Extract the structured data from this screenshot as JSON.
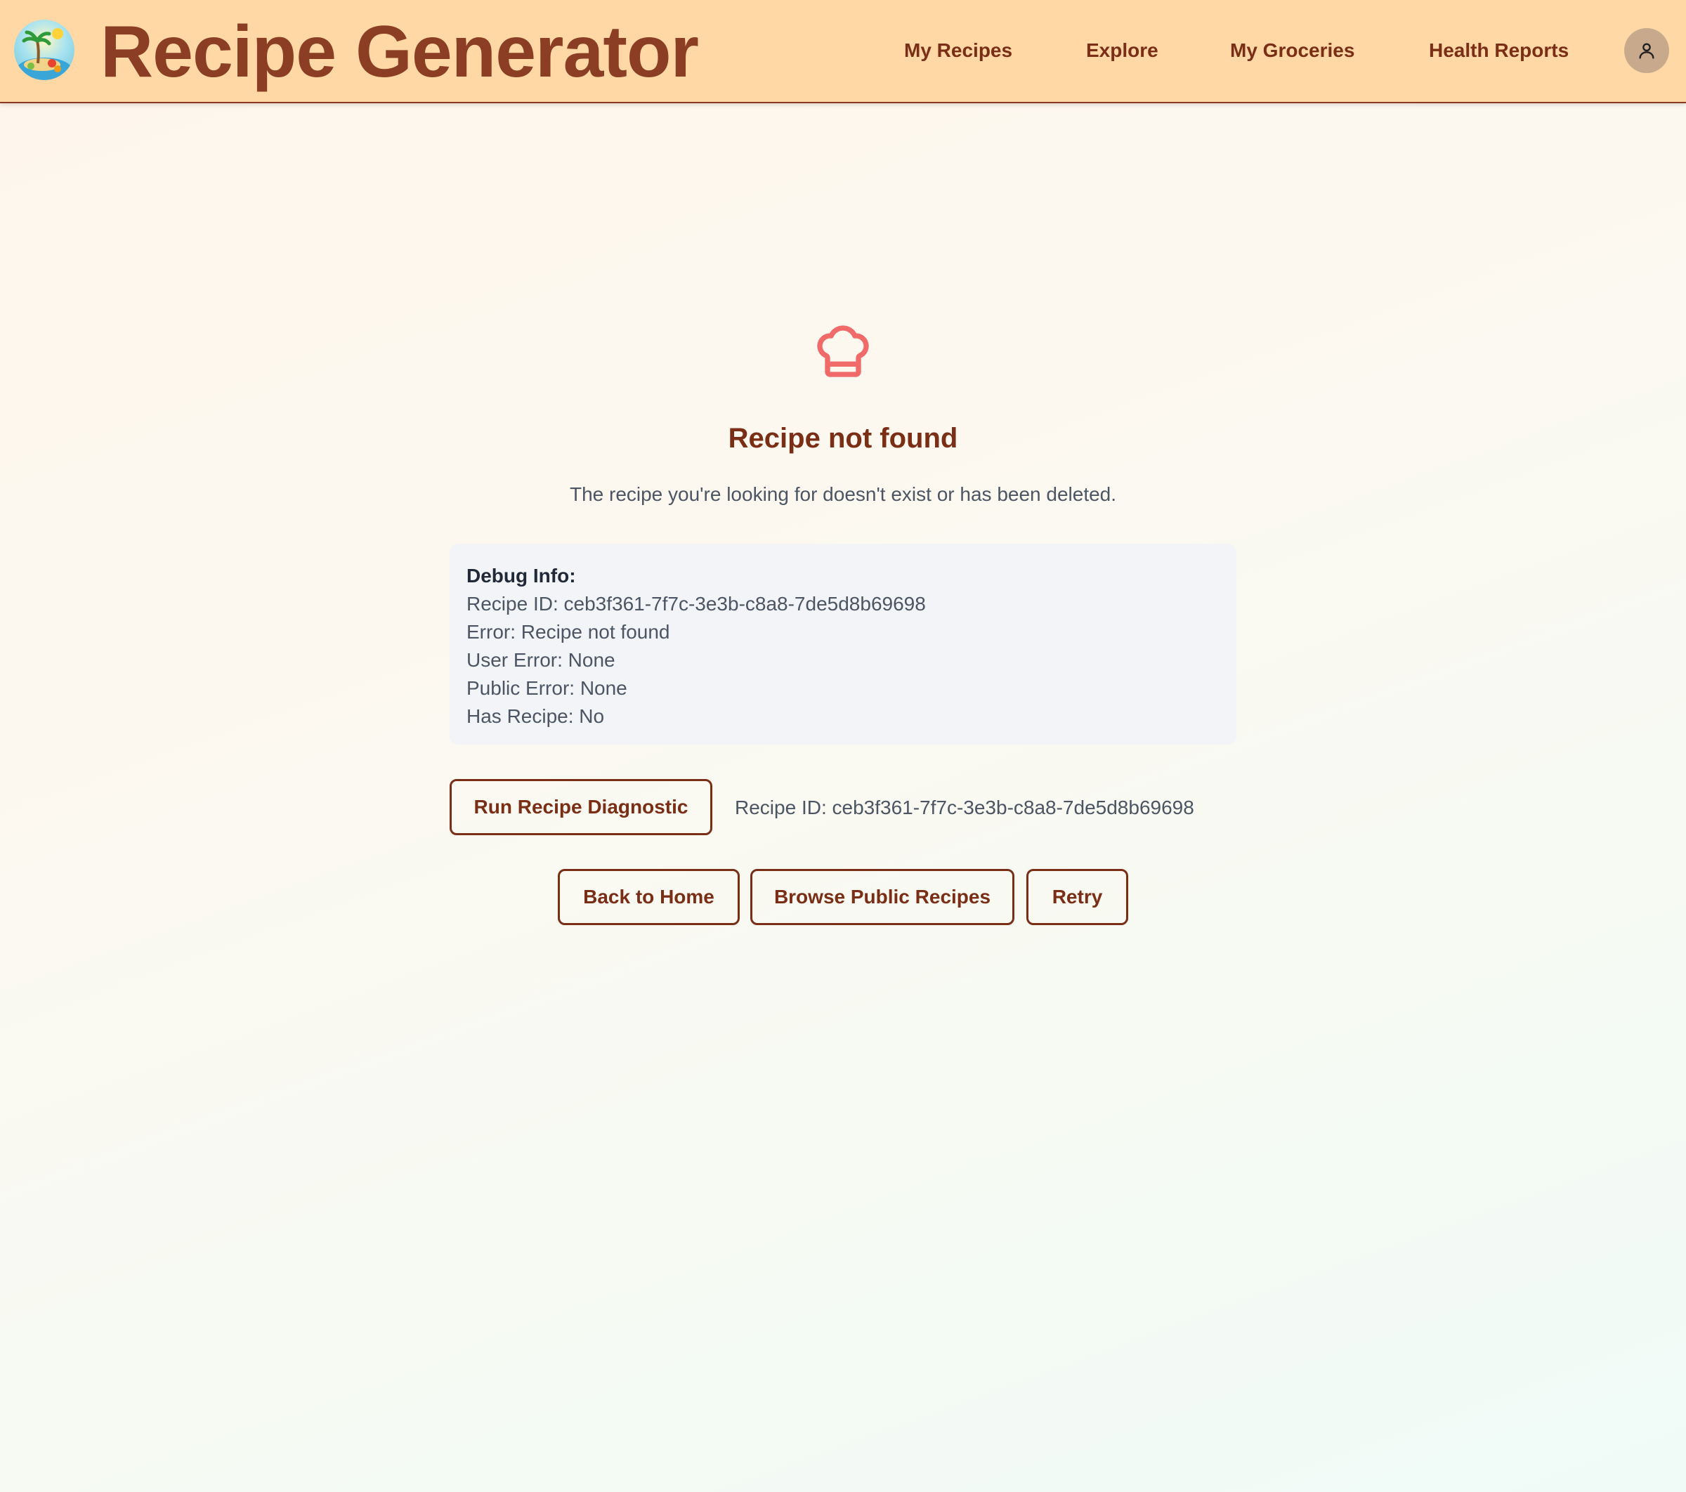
{
  "header": {
    "app_title": "Recipe Generator",
    "logo_icon": "tropical-island-logo",
    "nav": [
      {
        "label": "My Recipes"
      },
      {
        "label": "Explore"
      },
      {
        "label": "My Groceries"
      },
      {
        "label": "Health Reports"
      }
    ],
    "avatar_icon": "user-icon"
  },
  "main": {
    "icon": "chef-hat-icon",
    "heading": "Recipe not found",
    "message": "The recipe you're looking for doesn't exist or has been deleted.",
    "debug": {
      "title": "Debug Info:",
      "lines": [
        "Recipe ID: ceb3f361-7f7c-3e3b-c8a8-7de5d8b69698",
        "Error: Recipe not found",
        "User Error: None",
        "Public Error: None",
        "Has Recipe: No"
      ]
    },
    "diagnostic": {
      "button_label": "Run Recipe Diagnostic",
      "recipe_id_text": "Recipe ID: ceb3f361-7f7c-3e3b-c8a8-7de5d8b69698"
    },
    "actions": {
      "home_label": "Back to Home",
      "browse_label": "Browse Public Recipes",
      "retry_label": "Retry"
    }
  },
  "colors": {
    "header_bg": "#ffd8a6",
    "brand": "#8b3e24",
    "accent_dark": "#7a2e16",
    "icon_red": "#f06a6a",
    "debug_bg": "#f2f4f7"
  }
}
